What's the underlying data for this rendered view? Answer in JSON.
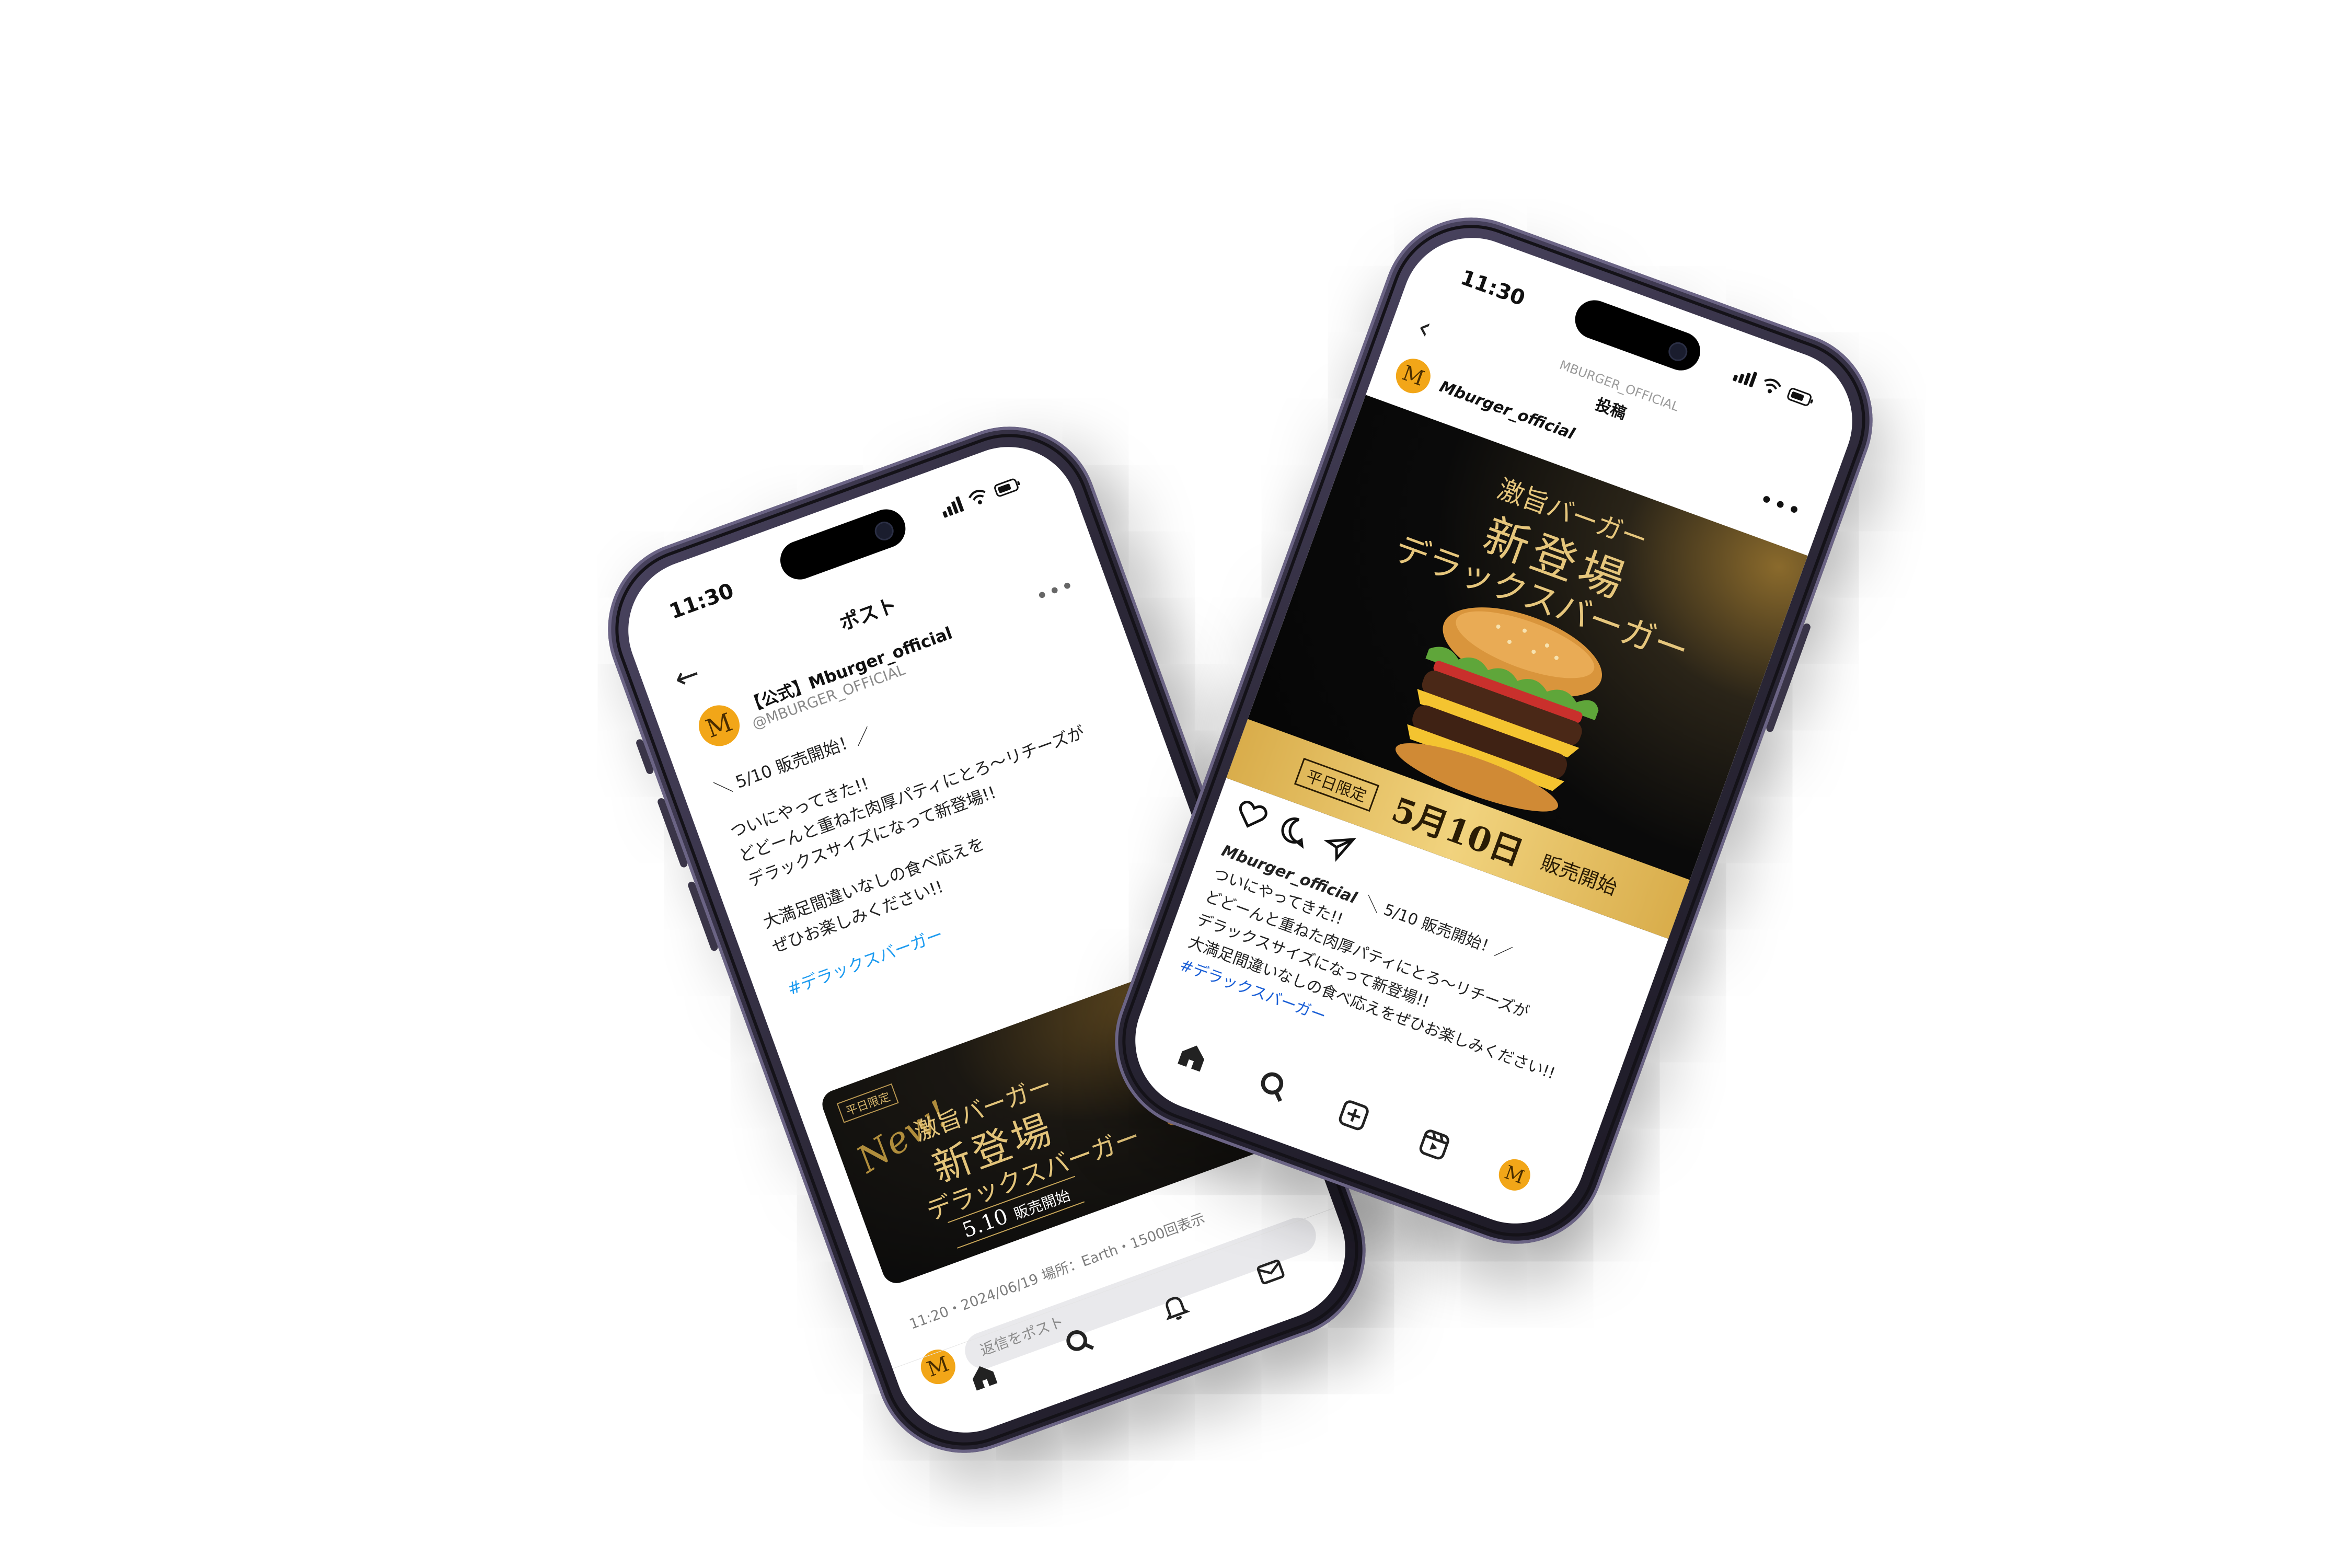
{
  "left_phone": {
    "status": {
      "time": "11:30"
    },
    "header": {
      "back_icon": "arrow-left-icon",
      "title": "ポスト"
    },
    "user": {
      "avatar_letter": "M",
      "name": "【公式】Mburger_official",
      "handle": "@MBURGER_OFFICIAL",
      "more_icon": "more-horizontal-icon"
    },
    "post": {
      "line1": "＼ 5/10 販売開始！／",
      "para2_line1": "ついにやってきた!!",
      "para2_line2": "どどーんと重ねた肉厚パティにとろ～リチーズが",
      "para2_line3": "デラックスサイズになって新登場!!",
      "para3_line1": "大満足間違いなしの食べ応えを",
      "para3_line2": "ぜひお楽しみください!!",
      "hashtag": "#デラックスバーガー"
    },
    "card": {
      "limited": "平日限定",
      "new": "New!",
      "line1": "激旨バーガー",
      "line2": "新登場",
      "line3": "デラックスバーガー",
      "date": "5.10",
      "date_suffix": "販売開始"
    },
    "meta": "11:20・2024/06/19 場所：Earth・1500回表示",
    "reply": {
      "avatar_letter": "M",
      "placeholder": "返信をポスト"
    },
    "tabbar": [
      "home-icon",
      "search-icon",
      "bell-icon",
      "mail-icon"
    ]
  },
  "right_phone": {
    "status": {
      "time": "11:30"
    },
    "header": {
      "back_icon": "chevron-left-icon",
      "subtitle": "MBURGER_OFFICIAL",
      "title": "投稿"
    },
    "user": {
      "avatar_letter": "M",
      "name": "Mburger_official",
      "more_icon": "more-horizontal-icon"
    },
    "image": {
      "line1": "激旨バーガー",
      "line2": "新登場",
      "line3": "デラックスバーガー",
      "banner_limited": "平日限定",
      "banner_date": "5月10日",
      "banner_suffix": "販売開始"
    },
    "actions": [
      "heart-icon",
      "comment-icon",
      "share-icon"
    ],
    "caption": {
      "username": "Mburger_official",
      "line1": "＼ 5/10 販売開始！／",
      "line2": "ついにやってきた!!",
      "line3": "どどーんと重ねた肉厚パティにとろ～リチーズが",
      "line4": "デラックスサイズになって新登場!!",
      "line5": "大満足間違いなしの食べ応えをぜひお楽しみください!!",
      "hashtag": "#デラックスバーガー"
    },
    "tabbar": [
      "home-icon",
      "search-icon",
      "add-post-icon",
      "reels-icon",
      "profile-avatar"
    ],
    "tabbar_avatar_letter": "M"
  },
  "colors": {
    "brand_gold": "#e6c67c",
    "avatar_orange": "#f2a618",
    "link_blue": "#1d9bf0",
    "frame_purple": "#2c2838"
  }
}
